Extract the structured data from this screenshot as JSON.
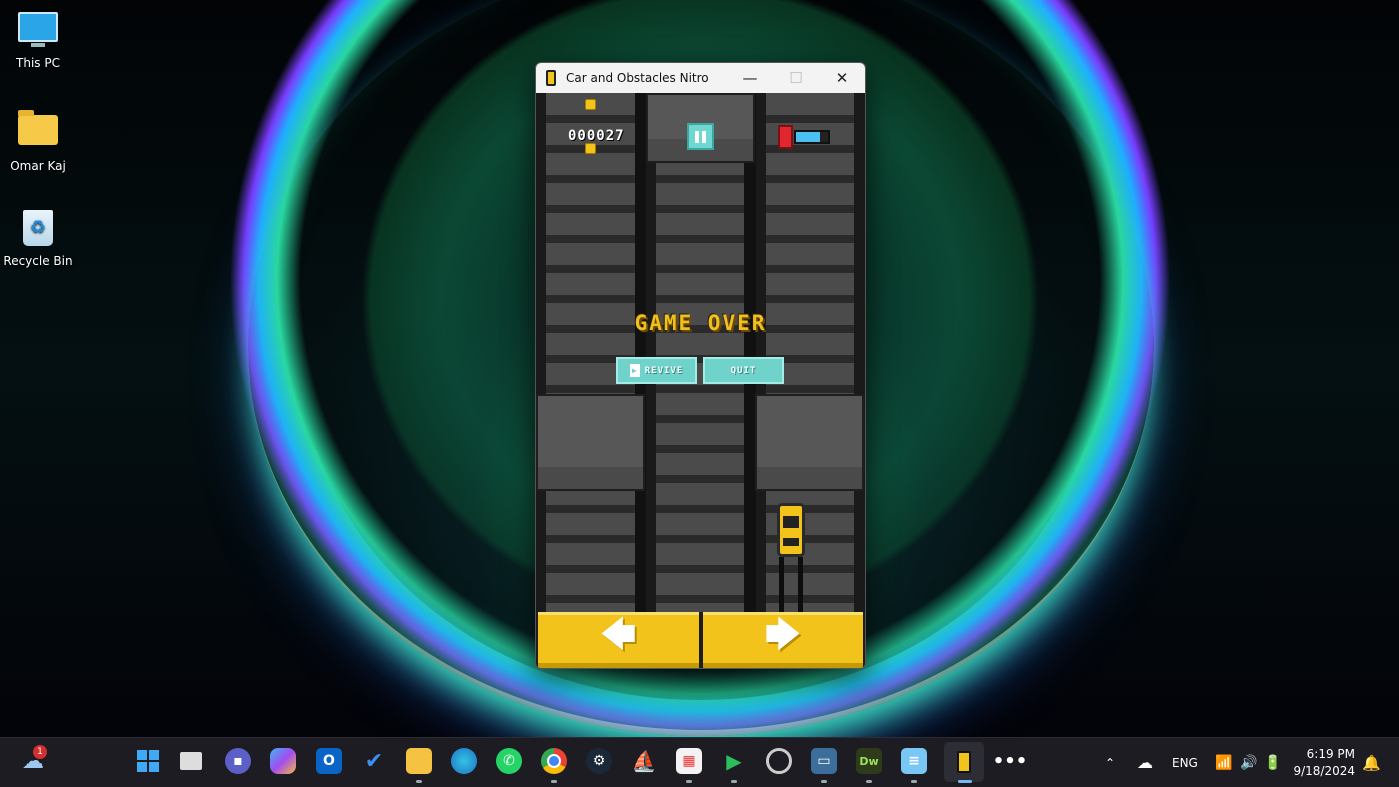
{
  "desktop": {
    "icons": [
      {
        "label": "This PC",
        "icon": "computer-icon"
      },
      {
        "label": "Omar Kaj",
        "icon": "folder-icon"
      },
      {
        "label": "Recycle Bin",
        "icon": "recycle-bin-icon"
      }
    ]
  },
  "window": {
    "title": "Car and Obstacles Nitro",
    "minimize": "—",
    "maximize": "☐",
    "close": "✕"
  },
  "game": {
    "score": "000027",
    "status": "GAME OVER",
    "revive_label": "REVIVE",
    "quit_label": "QUIT",
    "fuel_level": 0.75,
    "left_arrow": "🡄",
    "right_arrow": "🡆"
  },
  "taskbar": {
    "weather_badge": "1",
    "apps": [
      "start-icon",
      "task-view-icon",
      "teams-icon",
      "copilot-icon",
      "outlook-icon",
      "todo-icon",
      "file-explorer-icon",
      "edge-icon",
      "whatsapp-icon",
      "chrome-icon",
      "steam-icon",
      "azure-data-studio-icon",
      "microsoft-store-icon",
      "media-player-icon",
      "obs-icon",
      "windows-terminal-icon",
      "dreamweaver-icon",
      "notepad-icon",
      "car-obstacles-icon",
      "more-icon"
    ]
  },
  "tray": {
    "language": "ENG",
    "time": "6:19 PM",
    "date": "9/18/2024"
  }
}
